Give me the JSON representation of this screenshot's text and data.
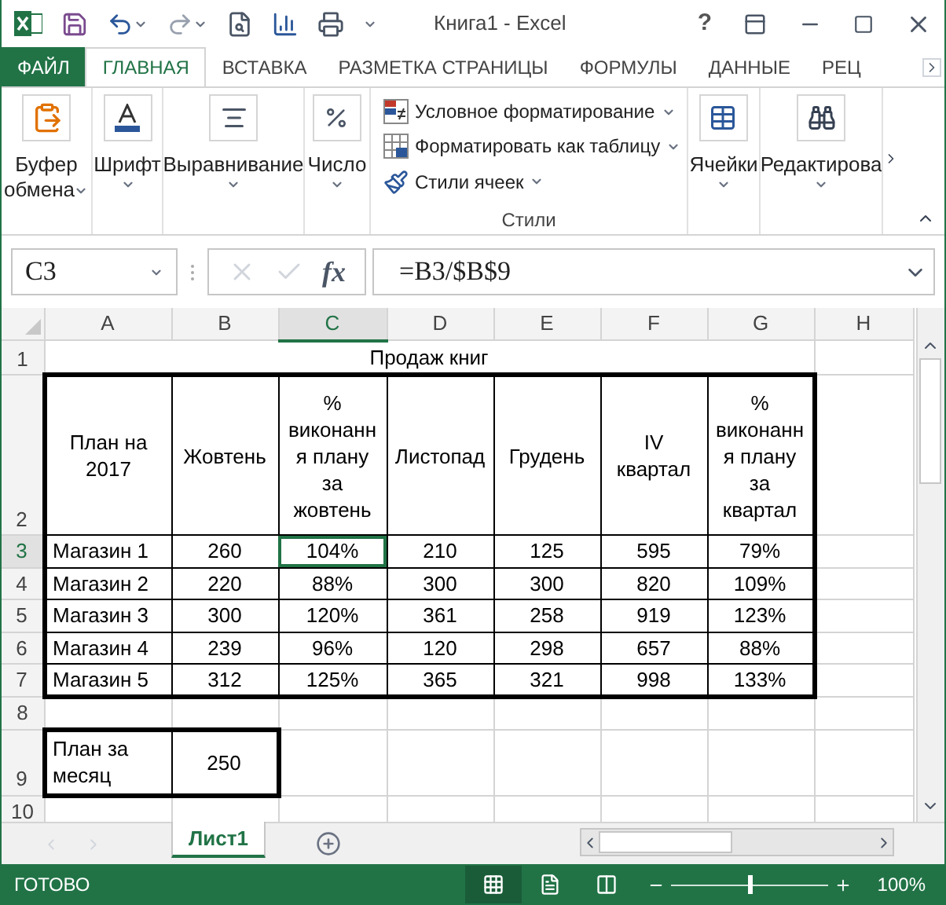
{
  "window": {
    "title": "Книга1 - Excel",
    "help": "?"
  },
  "ribbon_tabs": [
    {
      "label": "ФАЙЛ",
      "kind": "file",
      "selected": false
    },
    {
      "label": "ГЛАВНАЯ",
      "kind": "tab",
      "selected": true
    },
    {
      "label": "ВСТАВКА",
      "kind": "tab",
      "selected": false
    },
    {
      "label": "РАЗМЕТКА СТРАНИЦЫ",
      "kind": "tab",
      "selected": false
    },
    {
      "label": "ФОРМУЛЫ",
      "kind": "tab",
      "selected": false
    },
    {
      "label": "ДАННЫЕ",
      "kind": "tab",
      "selected": false
    },
    {
      "label": "РЕЦ",
      "kind": "tab",
      "selected": false
    }
  ],
  "ribbon_groups": [
    {
      "kind": "paste",
      "label": "Буфер обмена"
    },
    {
      "kind": "font",
      "label": "Шрифт"
    },
    {
      "kind": "align",
      "label": "Выравнивание"
    },
    {
      "kind": "number",
      "label": "Число"
    },
    {
      "kind": "styles",
      "label": "Стили",
      "items": [
        "Условное форматирование",
        "Форматировать как таблицу",
        "Стили ячеек"
      ]
    },
    {
      "kind": "cells",
      "label": "Ячейки"
    },
    {
      "kind": "find",
      "label": "Редактирова"
    }
  ],
  "formula_bar": {
    "name_box": "C3",
    "function_label": "fx",
    "formula": "=B3/$B$9"
  },
  "sheet": {
    "columns": [
      {
        "label": "A",
        "selected": false
      },
      {
        "label": "B",
        "selected": false
      },
      {
        "label": "C",
        "selected": true
      },
      {
        "label": "D",
        "selected": false
      },
      {
        "label": "E",
        "selected": false
      },
      {
        "label": "F",
        "selected": false
      },
      {
        "label": "G",
        "selected": false
      },
      {
        "label": "H",
        "selected": false
      }
    ],
    "rows": [
      {
        "number": "1",
        "kind": "title",
        "selected": false,
        "cells": [
          "Продаж книг"
        ]
      },
      {
        "number": "2",
        "kind": "header",
        "selected": false,
        "cells": [
          "План на 2017",
          "Жовтень",
          "% виконання плану за жовтень",
          "Листопад",
          "Грудень",
          "IV квартал",
          "% виконання плану за квартал"
        ]
      },
      {
        "number": "3",
        "kind": "data",
        "selected": true,
        "cells": [
          "Магазин 1",
          "260",
          "104%",
          "210",
          "125",
          "595",
          "79%"
        ]
      },
      {
        "number": "4",
        "kind": "data",
        "selected": false,
        "cells": [
          "Магазин 2",
          "220",
          "88%",
          "300",
          "300",
          "820",
          "109%"
        ]
      },
      {
        "number": "5",
        "kind": "data",
        "selected": false,
        "cells": [
          "Магазин 3",
          "300",
          "120%",
          "361",
          "258",
          "919",
          "123%"
        ]
      },
      {
        "number": "6",
        "kind": "data",
        "selected": false,
        "cells": [
          "Магазин 4",
          "239",
          "96%",
          "120",
          "298",
          "657",
          "88%"
        ]
      },
      {
        "number": "7",
        "kind": "data",
        "selected": false,
        "cells": [
          "Магазин 5",
          "312",
          "125%",
          "365",
          "321",
          "998",
          "133%"
        ]
      },
      {
        "number": "8",
        "kind": "empty",
        "selected": false
      },
      {
        "number": "9",
        "kind": "plan",
        "selected": false,
        "cells": [
          "План за месяц",
          "250"
        ]
      },
      {
        "number": "10",
        "kind": "empty",
        "selected": false
      }
    ]
  },
  "sheet_tabs": [
    {
      "label": "Лист1",
      "selected": true
    }
  ],
  "status_bar": {
    "status": "ГОТОВО",
    "views": [
      {
        "kind": "normal",
        "selected": true
      },
      {
        "kind": "layout",
        "selected": false
      },
      {
        "kind": "pagebreak",
        "selected": false
      }
    ],
    "zoom": {
      "level": 0.5,
      "label": "100%"
    }
  }
}
